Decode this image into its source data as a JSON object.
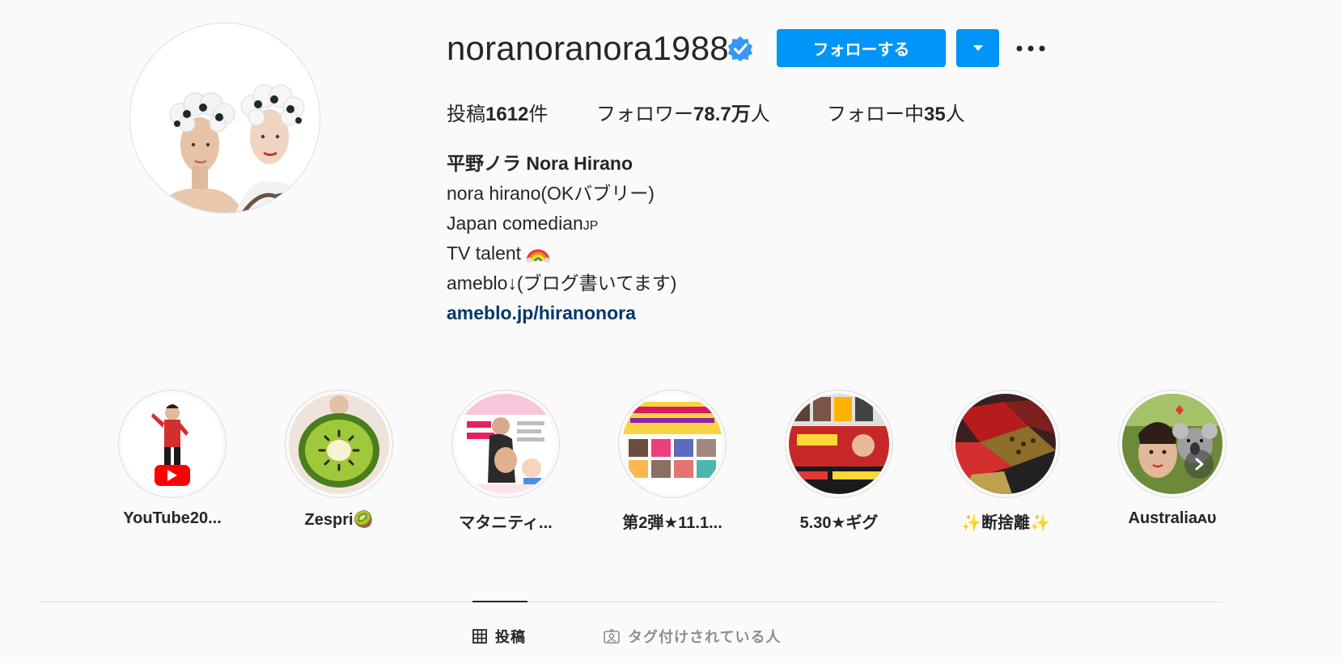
{
  "profile": {
    "username": "noranoranora1988",
    "verified": true,
    "follow_label": "フォローする",
    "dropdown_icon": "chevron-down-icon",
    "more_icon": "more-horizontal-icon",
    "accent_color": "#0095f6"
  },
  "stats": {
    "posts_prefix": "投稿",
    "posts_count": "1612",
    "posts_suffix": "件",
    "followers_prefix": "フォロワー",
    "followers_count": "78.7万",
    "followers_suffix": "人",
    "following_prefix": "フォロー中",
    "following_count": "35",
    "following_suffix": "人"
  },
  "bio": {
    "full_name": "平野ノラ Nora Hirano",
    "line1": "nora hirano(OKバブリー)",
    "line2_text": "Japan comedian",
    "line2_flag": "JP",
    "line3_text": "TV talent",
    "line3_emoji": "rainbow-emoji",
    "line4": "ameblo↓(ブログ書いてます)",
    "link": "ameblo.jp/hiranonora",
    "link_color": "#00376b"
  },
  "highlights": [
    {
      "label": "YouTube20...",
      "icon": "youtube-icon"
    },
    {
      "label": "Zespri🥝",
      "icon": "kiwi-icon"
    },
    {
      "label": "マタニティ...",
      "icon": "maternity-icon"
    },
    {
      "label": "第2弾★11.1...",
      "icon": "event-poster-icon"
    },
    {
      "label": "5.30★ギグ",
      "icon": "gig-poster-icon"
    },
    {
      "label": "✨断捨離✨",
      "icon": "clothes-icon"
    },
    {
      "label": "Australiaᴀᴜ",
      "icon": "koala-icon"
    }
  ],
  "tabs": [
    {
      "label": "投稿",
      "icon": "grid-icon",
      "active": true
    },
    {
      "label": "タグ付けされている人",
      "icon": "tagged-user-icon",
      "active": false
    }
  ]
}
